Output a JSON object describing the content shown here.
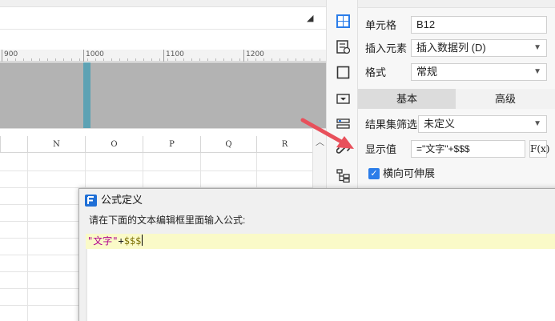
{
  "ruler": {
    "labels": [
      "900",
      "1000",
      "1100",
      "1200"
    ]
  },
  "grid": {
    "columns": [
      "N",
      "O",
      "P",
      "Q",
      "R"
    ]
  },
  "icon_strip": {
    "icons": [
      "cell-element-icon",
      "cell-attribute-icon",
      "widget-icon",
      "condition-icon",
      "filter-icon",
      "link-icon",
      "tree-icon"
    ]
  },
  "panel": {
    "cell_label": "单元格",
    "cell_value": "B12",
    "insert_label": "插入元素",
    "insert_value": "插入数据列 (D)",
    "format_label": "格式",
    "format_value": "常规",
    "tab_basic": "基本",
    "tab_advanced": "高级",
    "filter_label": "结果集筛选",
    "filter_value": "未定义",
    "display_label": "显示值",
    "display_value": "=\"文字\"+$$$",
    "fx_label": "F(x)",
    "expand_label": "横向可伸展",
    "expand_checked": true
  },
  "dialog": {
    "title": "公式定义",
    "prompt": "请在下面的文本编辑框里面输入公式:",
    "formula_string": "\"文字\"",
    "formula_operator": "+",
    "formula_variable": "$$$"
  },
  "colors": {
    "accent": "#2b7de9",
    "arrow": "#e8505b",
    "canvas_marker": "#5da2b4",
    "editor_highlight": "#fafac8"
  }
}
